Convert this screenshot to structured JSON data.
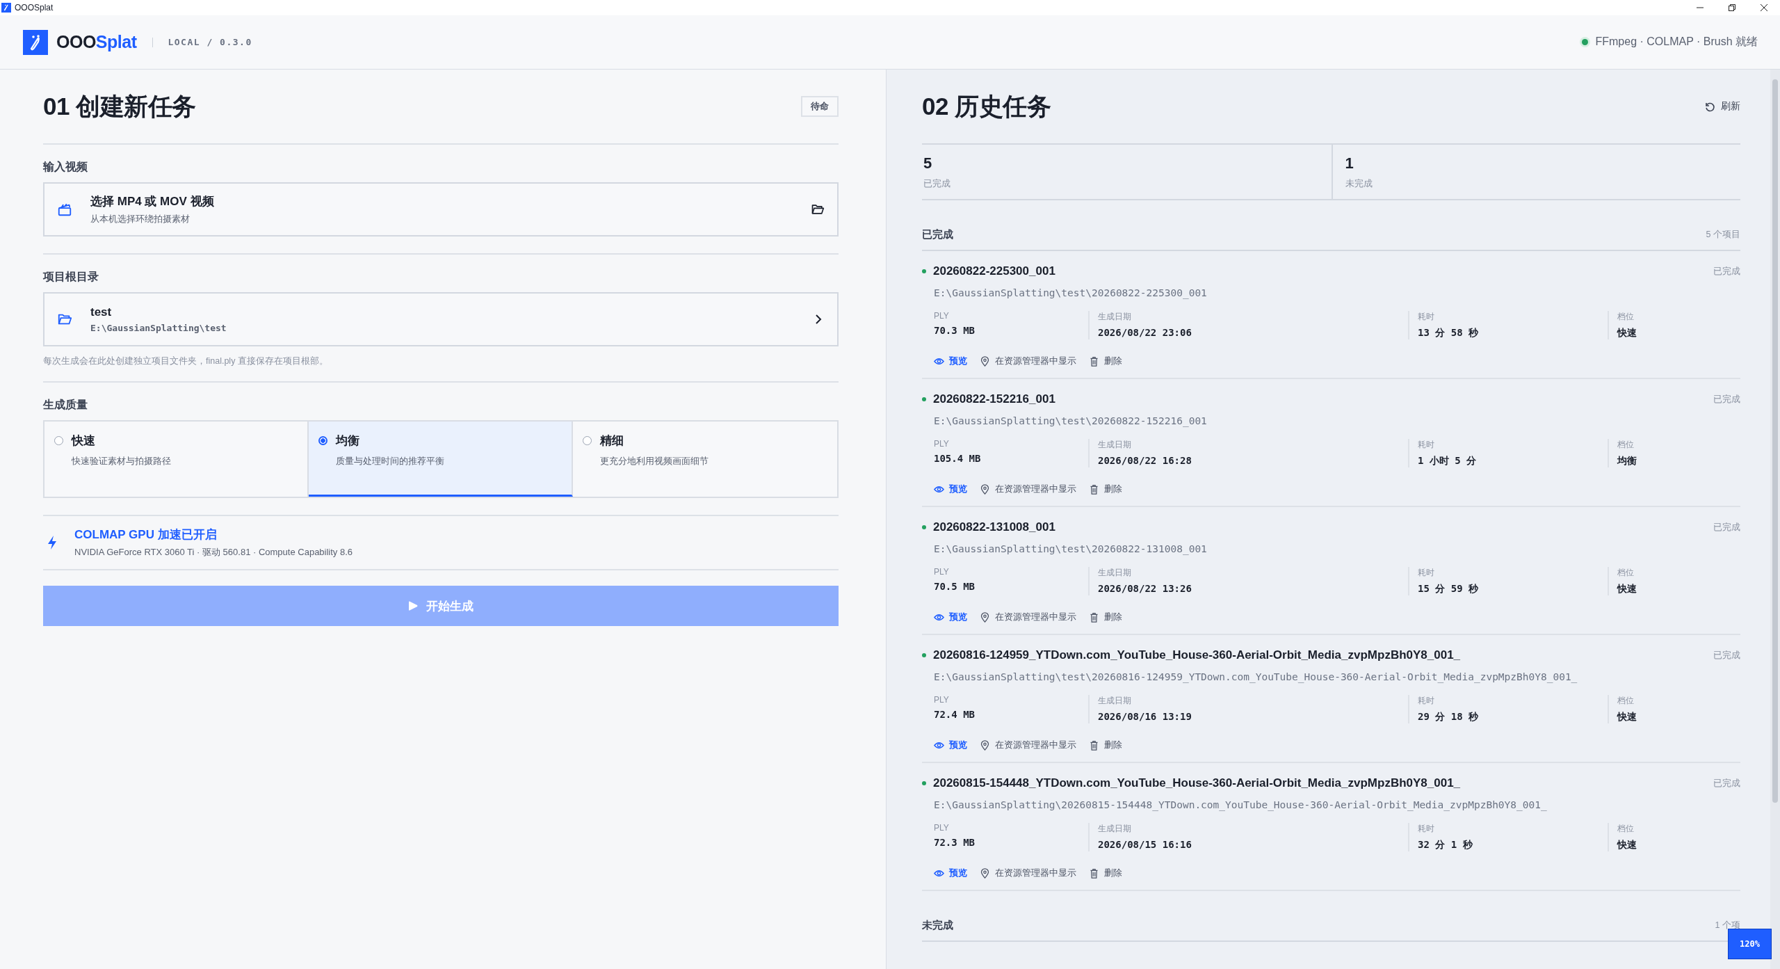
{
  "window": {
    "title": "OOOSplat"
  },
  "header": {
    "logo_prefix": "OOO",
    "logo_suffix": "Splat",
    "version": "LOCAL / 0.3.0",
    "status": "FFmpeg · COLMAP · Brush 就绪",
    "status_ok": true
  },
  "create": {
    "title": "01 创建新任务",
    "state_badge": "待命",
    "video": {
      "label": "输入视频",
      "title": "选择 MP4 或 MOV 视频",
      "subtitle": "从本机选择环绕拍摄素材"
    },
    "root": {
      "label": "项目根目录",
      "name": "test",
      "path": "E:\\GaussianSplatting\\test",
      "hint": "每次生成会在此处创建独立项目文件夹，final.ply 直接保存在项目根部。"
    },
    "quality": {
      "label": "生成质量",
      "options": [
        {
          "label": "快速",
          "desc": "快速验证素材与拍摄路径",
          "selected": false
        },
        {
          "label": "均衡",
          "desc": "质量与处理时间的推荐平衡",
          "selected": true
        },
        {
          "label": "精细",
          "desc": "更充分地利用视频画面细节",
          "selected": false
        }
      ]
    },
    "gpu": {
      "title": "COLMAP GPU 加速已开启",
      "detail": "NVIDIA GeForce RTX 3060 Ti · 驱动 560.81 · Compute Capability 8.6",
      "enabled": true
    },
    "start_button": {
      "label": "开始生成",
      "disabled": true
    }
  },
  "history": {
    "title": "02 历史任务",
    "refresh": "刷新",
    "stats": [
      {
        "value": "5",
        "label": "已完成"
      },
      {
        "value": "1",
        "label": "未完成"
      }
    ],
    "sections": [
      {
        "title": "已完成",
        "count": "5 个项目",
        "tasks": [
          {
            "name": "20260822-225300_001",
            "status": "已完成",
            "path": "E:\\GaussianSplatting\\test\\20260822-225300_001",
            "fields": [
              {
                "label": "PLY",
                "value": "70.3 MB"
              },
              {
                "label": "生成日期",
                "value": "2026/08/22 23:06"
              },
              {
                "label": "耗时",
                "value": "13 分 58 秒"
              },
              {
                "label": "档位",
                "value": "快速"
              }
            ],
            "actions": [
              {
                "kind": "preview",
                "label": "预览"
              },
              {
                "kind": "reveal",
                "label": "在资源管理器中显示"
              },
              {
                "kind": "delete",
                "label": "删除"
              }
            ]
          },
          {
            "name": "20260822-152216_001",
            "status": "已完成",
            "path": "E:\\GaussianSplatting\\test\\20260822-152216_001",
            "fields": [
              {
                "label": "PLY",
                "value": "105.4 MB"
              },
              {
                "label": "生成日期",
                "value": "2026/08/22 16:28"
              },
              {
                "label": "耗时",
                "value": "1 小时 5 分"
              },
              {
                "label": "档位",
                "value": "均衡"
              }
            ],
            "actions": [
              {
                "kind": "preview",
                "label": "预览"
              },
              {
                "kind": "reveal",
                "label": "在资源管理器中显示"
              },
              {
                "kind": "delete",
                "label": "删除"
              }
            ]
          },
          {
            "name": "20260822-131008_001",
            "status": "已完成",
            "path": "E:\\GaussianSplatting\\test\\20260822-131008_001",
            "fields": [
              {
                "label": "PLY",
                "value": "70.5 MB"
              },
              {
                "label": "生成日期",
                "value": "2026/08/22 13:26"
              },
              {
                "label": "耗时",
                "value": "15 分 59 秒"
              },
              {
                "label": "档位",
                "value": "快速"
              }
            ],
            "actions": [
              {
                "kind": "preview",
                "label": "预览"
              },
              {
                "kind": "reveal",
                "label": "在资源管理器中显示"
              },
              {
                "kind": "delete",
                "label": "删除"
              }
            ]
          },
          {
            "name": "20260816-124959_YTDown.com_YouTube_House-360-Aerial-Orbit_Media_zvpMpzBh0Y8_001_",
            "status": "已完成",
            "path": "E:\\GaussianSplatting\\test\\20260816-124959_YTDown.com_YouTube_House-360-Aerial-Orbit_Media_zvpMpzBh0Y8_001_",
            "fields": [
              {
                "label": "PLY",
                "value": "72.4 MB"
              },
              {
                "label": "生成日期",
                "value": "2026/08/16 13:19"
              },
              {
                "label": "耗时",
                "value": "29 分 18 秒"
              },
              {
                "label": "档位",
                "value": "快速"
              }
            ],
            "actions": [
              {
                "kind": "preview",
                "label": "预览"
              },
              {
                "kind": "reveal",
                "label": "在资源管理器中显示"
              },
              {
                "kind": "delete",
                "label": "删除"
              }
            ]
          },
          {
            "name": "20260815-154448_YTDown.com_YouTube_House-360-Aerial-Orbit_Media_zvpMpzBh0Y8_001_",
            "status": "已完成",
            "path": "E:\\GaussianSplatting\\20260815-154448_YTDown.com_YouTube_House-360-Aerial-Orbit_Media_zvpMpzBh0Y8_001_",
            "fields": [
              {
                "label": "PLY",
                "value": "72.3 MB"
              },
              {
                "label": "生成日期",
                "value": "2026/08/15 16:16"
              },
              {
                "label": "耗时",
                "value": "32 分 1 秒"
              },
              {
                "label": "档位",
                "value": "快速"
              }
            ],
            "actions": [
              {
                "kind": "preview",
                "label": "预览"
              },
              {
                "kind": "reveal",
                "label": "在资源管理器中显示"
              },
              {
                "kind": "delete",
                "label": "删除"
              }
            ]
          }
        ]
      },
      {
        "title": "未完成",
        "count": "1 个项"
      }
    ]
  },
  "zoom_badge": "120%"
}
